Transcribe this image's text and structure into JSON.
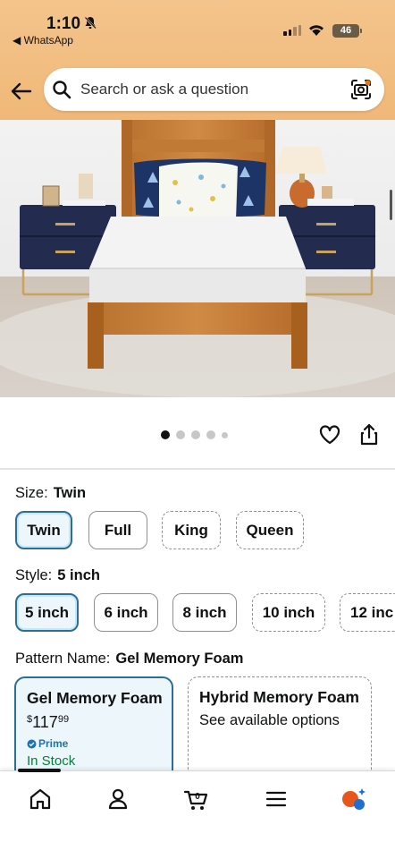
{
  "status_bar": {
    "time": "1:10",
    "back_app": "◀ WhatsApp",
    "battery": "46"
  },
  "search": {
    "placeholder": "Search or ask a question"
  },
  "image_carousel": {
    "dot_count": 5,
    "active_index": 0
  },
  "size": {
    "label": "Size:",
    "selected": "Twin",
    "options": [
      "Twin",
      "Full",
      "King",
      "Queen"
    ]
  },
  "style": {
    "label": "Style:",
    "selected": "5 inch",
    "options": [
      "5 inch",
      "6 inch",
      "8 inch",
      "10 inch",
      "12 inc"
    ]
  },
  "pattern": {
    "label": "Pattern Name:",
    "selected": "Gel Memory Foam",
    "cards": [
      {
        "title": "Gel Memory Foam",
        "price_symbol": "$",
        "price_whole": "117",
        "price_fraction": "99",
        "prime": "Prime",
        "stock": "In Stock"
      },
      {
        "title": "Hybrid Memory Foam",
        "subtitle": "See available options"
      }
    ]
  },
  "colors": {
    "header": "#f0b878",
    "selected_border": "#2a6f97",
    "in_stock": "#067d3c",
    "prime": "#1a73b6"
  }
}
